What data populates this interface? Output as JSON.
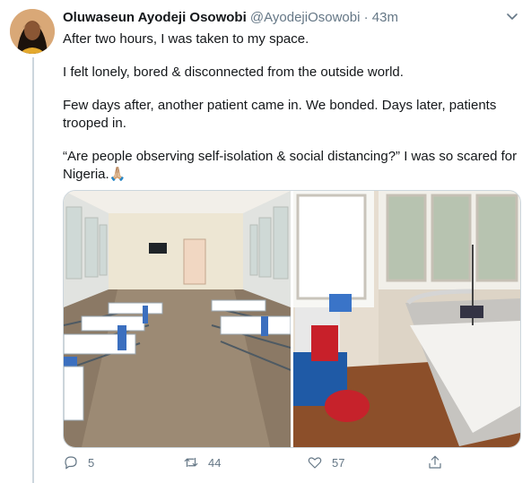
{
  "tweet": {
    "author_name": "Oluwaseun Ayodeji Osowobi",
    "handle": "@AyodejiOsowobi",
    "separator": "·",
    "time": "43m",
    "paragraphs": [
      "After two hours, I was taken to my space.",
      "I felt lonely, bored & disconnected from the outside world.",
      "Few days after, another patient came in. We bonded. Days later, patients trooped in.",
      "“Are people observing self-isolation & social distancing?” I was so scared for Nigeria.🙏🏼"
    ],
    "media": [
      {
        "icon": "photo-hospital-ward-icon"
      },
      {
        "icon": "photo-hospital-bed-icon"
      }
    ]
  },
  "actions": {
    "reply_count": "5",
    "retweet_count": "44",
    "like_count": "57"
  },
  "colors": {
    "text": "#14171a",
    "muted": "#657786",
    "border": "#ccd6dd"
  }
}
